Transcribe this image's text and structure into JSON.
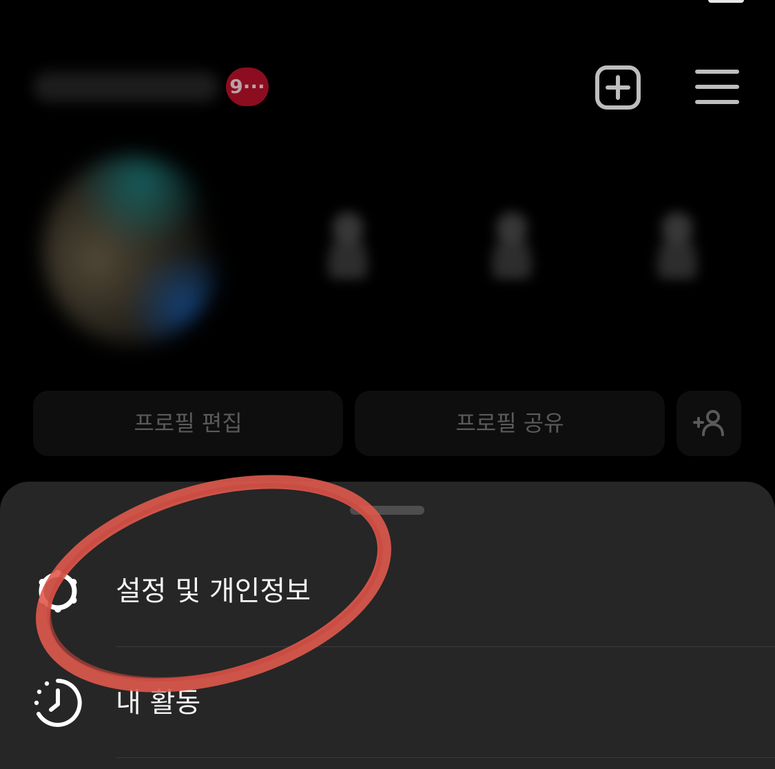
{
  "header": {
    "notification_badge": "9···",
    "create_icon": "plus-square-icon",
    "menu_icon": "hamburger-menu-icon"
  },
  "profile_actions": {
    "edit_label": "프로필 편집",
    "share_label": "프로필 공유",
    "add_person_icon": "add-person-icon"
  },
  "sheet": {
    "items": [
      {
        "label": "설정 및 개인정보",
        "icon": "gear-icon"
      },
      {
        "label": "내 활동",
        "icon": "activity-clock-icon"
      }
    ]
  },
  "colors": {
    "background": "#000000",
    "sheet": "#262626",
    "badge": "#8c0d1f",
    "annotation": "#e05a4e"
  }
}
